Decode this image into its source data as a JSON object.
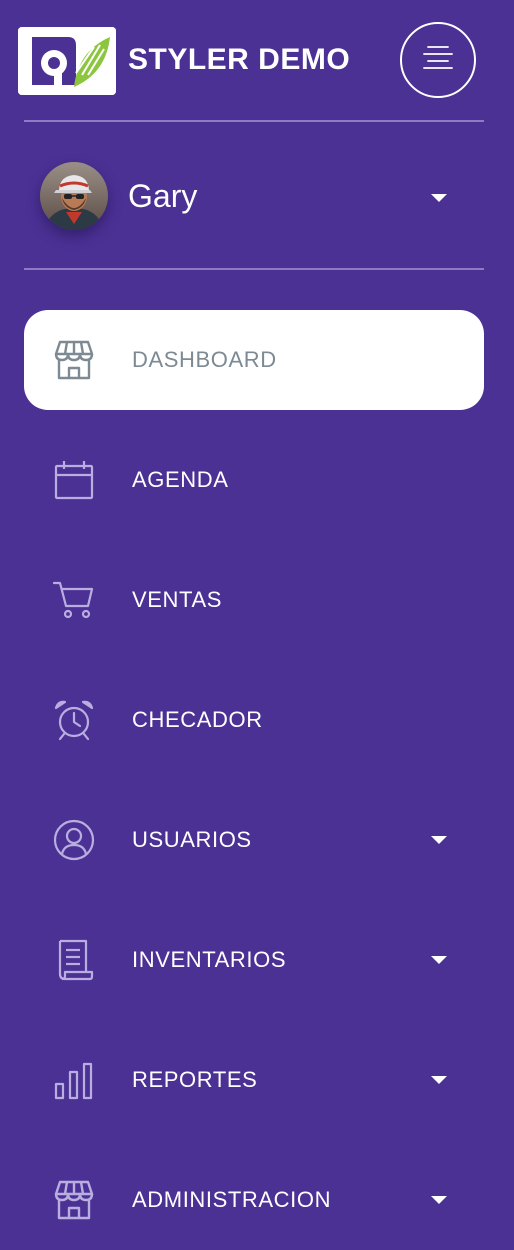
{
  "app": {
    "title": "STYLER DEMO"
  },
  "user": {
    "name": "Gary"
  },
  "nav": {
    "items": [
      {
        "label": "DASHBOARD",
        "icon": "store-icon",
        "active": true,
        "has_submenu": false
      },
      {
        "label": "AGENDA",
        "icon": "calendar-icon",
        "active": false,
        "has_submenu": false
      },
      {
        "label": "VENTAS",
        "icon": "cart-icon",
        "active": false,
        "has_submenu": false
      },
      {
        "label": "CHECADOR",
        "icon": "alarm-clock-icon",
        "active": false,
        "has_submenu": false
      },
      {
        "label": "USUARIOS",
        "icon": "user-circle-icon",
        "active": false,
        "has_submenu": true
      },
      {
        "label": "INVENTARIOS",
        "icon": "document-icon",
        "active": false,
        "has_submenu": true
      },
      {
        "label": "REPORTES",
        "icon": "bar-chart-icon",
        "active": false,
        "has_submenu": true
      },
      {
        "label": "ADMINISTRACION",
        "icon": "store-icon",
        "active": false,
        "has_submenu": true
      }
    ]
  },
  "colors": {
    "background": "#4c3195",
    "active_item_bg": "#ffffff",
    "active_item_text": "#7d8a93",
    "icon_stroke": "#b9aee0",
    "divider": "#8d7cc4",
    "logo_accent": "#8cc63f"
  }
}
